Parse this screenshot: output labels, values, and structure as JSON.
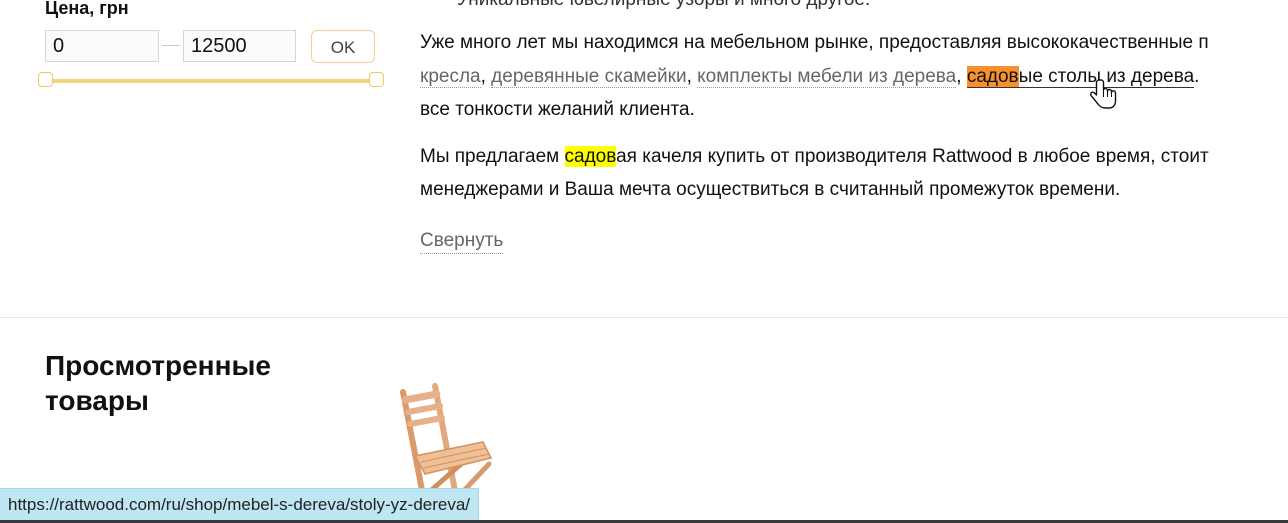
{
  "filter": {
    "title": "Цена, грн",
    "min_value": "0",
    "max_value": "12500",
    "ok_label": "OK",
    "accent_color": "#f4d47e"
  },
  "description": {
    "cut_line": "Уникальные ювелирные узоры и много другое.",
    "p1": {
      "text_a": "Уже много лет мы находимся на мебельном рынке, предоставляя высококачественные п",
      "link_armchairs": "кресла",
      "sep1": ", ",
      "link_benches": "деревянные скамейки",
      "sep2": ", ",
      "link_sets": "комплекты мебели из дерева",
      "sep3": ", ",
      "link_tables_highlight": "садов",
      "link_tables_rest": "ые столы из дерева",
      "end1": ". ",
      "text_c": "все тонкости желаний клиента."
    },
    "p2": {
      "text_a": "Мы предлагаем ",
      "highlight": "садов",
      "text_b": "ая качеля купить от производителя Rattwood в любое время, стоит",
      "text_c": "менеджерами и Ваша мечта осуществиться в считанный промежуток времени."
    },
    "collapse_label": "Свернуть",
    "highlight_colors": {
      "orange": "#f5922f",
      "yellow": "#ffff00"
    }
  },
  "viewed": {
    "title": "Просмотренные товары",
    "product_icon": "folding-wooden-chair"
  },
  "status_bar": {
    "url": "https://rattwood.com/ru/shop/mebel-s-dereva/stoly-yz-dereva/"
  },
  "cursor": {
    "icon": "hand-pointer-cursor"
  }
}
